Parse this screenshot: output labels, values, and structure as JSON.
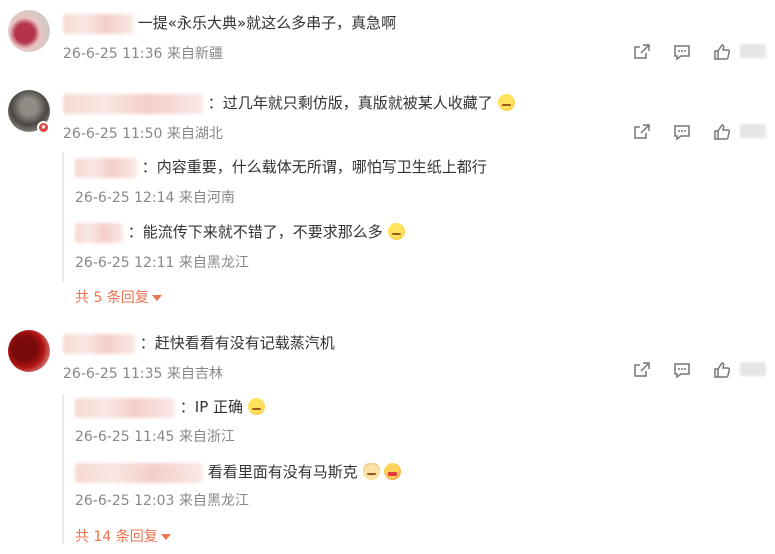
{
  "comments": [
    {
      "text": "一提«永乐大典»就这么多串子，真急啊",
      "meta": "26-6-25 11:36 来自新疆"
    },
    {
      "text": "：过几年就只剩仿版，真版就被某人收藏了",
      "meta": "26-6-25 11:50 来自湖北",
      "replies": [
        {
          "text": "：内容重要，什么载体无所谓，哪怕写卫生纸上都行",
          "meta": "26-6-25 12:14 来自河南"
        },
        {
          "text": "：能流传下来就不错了，不要求那么多",
          "meta": "26-6-25 12:11 来自黑龙江"
        }
      ],
      "more_label": "共 5 条回复"
    },
    {
      "text": "：赶快看看有没有记载蒸汽机",
      "meta": "26-6-25 11:35 来自吉林",
      "replies": [
        {
          "text": "：IP 正确",
          "meta": "26-6-25 11:45 来自浙江"
        },
        {
          "text": "看看里面有没有马斯克",
          "meta": "26-6-25 12:03 来自黑龙江"
        }
      ],
      "more_label": "共 14 条回复"
    }
  ],
  "icons": {
    "share": "share-icon",
    "comment": "comment-icon",
    "like": "thumbs-up-icon",
    "emoji": "emoji-icon"
  },
  "colors": {
    "accent": "#eb7350",
    "meta": "#888888",
    "text": "#333333"
  }
}
